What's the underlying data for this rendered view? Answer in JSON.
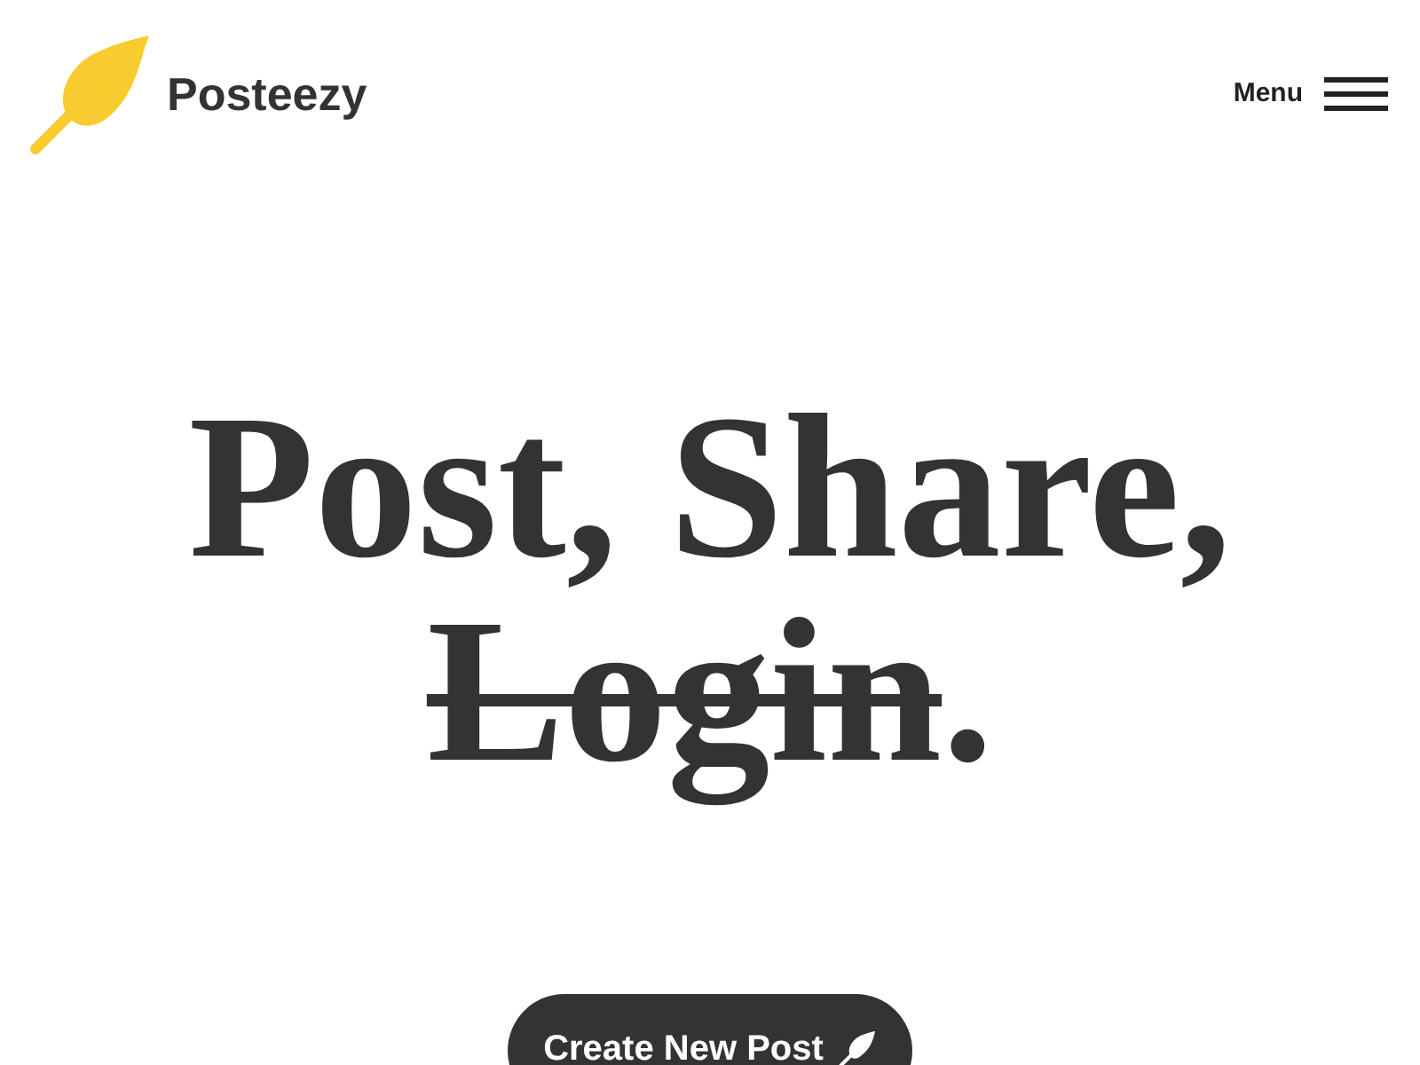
{
  "header": {
    "brand": "Posteezy",
    "menu_label": "Menu"
  },
  "headline": [
    {
      "text": "Post, Share,",
      "struck": false,
      "break": true
    },
    {
      "text": "Login",
      "struck": true,
      "break": false
    },
    {
      "text": ".",
      "struck": false,
      "break": false
    }
  ],
  "cta": {
    "label": "Create New Post"
  }
}
